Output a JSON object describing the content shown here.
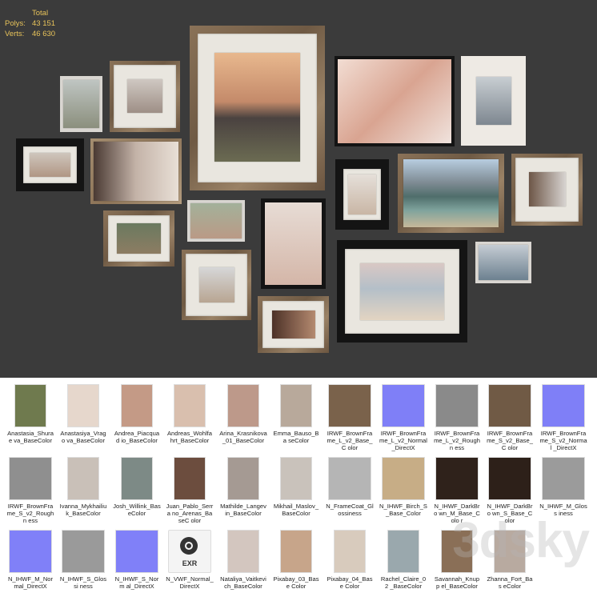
{
  "stats": {
    "total_label": "Total",
    "polys_label": "Polys:",
    "polys_value": "43 151",
    "verts_label": "Verts:",
    "verts_value": "46 630"
  },
  "watermark": "3dsky",
  "exr_label": "EXR",
  "textures": [
    {
      "name": "Anastasia_Shurae va_BaseColor",
      "color": "#6f7a4e"
    },
    {
      "name": "Anastasiya_Vrago va_BaseColor",
      "color": "#e6d7cc"
    },
    {
      "name": "Andrea_Piacquad io_BaseColor",
      "color": "#c49a86"
    },
    {
      "name": "Andreas_Wohlfa hrt_BaseColor",
      "color": "#d9bfae"
    },
    {
      "name": "Arina_Krasnikova _01_BaseColor",
      "color": "#bd998a"
    },
    {
      "name": "Emma_Bauso_Ba seColor",
      "color": "#b8a99b"
    },
    {
      "name": "IRWF_BrownFra me_L_v2_Base_C olor",
      "color": "#7a624b"
    },
    {
      "name": "IRWF_BrownFra me_L_v2_Normal _DirectX",
      "color": "#7f7ff7"
    },
    {
      "name": "IRWF_BrownFra me_L_v2_Roughn ess",
      "color": "#8a8a8a"
    },
    {
      "name": "IRWF_BrownFra me_S_v2_Base_C olor",
      "color": "#705a45"
    },
    {
      "name": "IRWF_BrownFra me_S_v2_Normal _DirectX",
      "color": "#7f7ff7"
    },
    {
      "name": "IRWF_BrownFra me_S_v2_Roughn ess",
      "color": "#8f8f8f"
    },
    {
      "name": "Ivanna_Mykhailiu k_BaseColor",
      "color": "#c9c0b8"
    },
    {
      "name": "Josh_Willink_Bas eColor",
      "color": "#7d8a86"
    },
    {
      "name": "Juan_Pablo_Serra no_Arenas_BaseC olor",
      "color": "#6c4d3e"
    },
    {
      "name": "Mathilde_Langev in_BaseColor",
      "color": "#a59a93"
    },
    {
      "name": "Mikhail_Maslov_ BaseColor",
      "color": "#c9c2bb"
    },
    {
      "name": "N_FrameCoat_Gl ossiness",
      "color": "#b5b5b5"
    },
    {
      "name": "N_IHWF_Birch_S _Base_Color",
      "color": "#c7ad86"
    },
    {
      "name": "N_IHWF_DarkBro wn_M_Base_Colo r",
      "color": "#2f221b"
    },
    {
      "name": "N_IHWF_DarkBro wn_S_Base_Color",
      "color": "#2d2019"
    },
    {
      "name": "N_IHWF_M_Gloss iness",
      "color": "#9b9b9b"
    },
    {
      "name": "N_IHWF_M_Nor mal_DirectX",
      "color": "#8080f8"
    },
    {
      "name": "N_IHWF_S_Glossi ness",
      "color": "#9a9a9a"
    },
    {
      "name": "N_IHWF_S_Norm al_DirectX",
      "color": "#8080f8"
    },
    {
      "name": "N_VWF_Normal_ DirectX",
      "color": "exr"
    },
    {
      "name": "Nataliya_Vaitkevi ch_BaseColor",
      "color": "#d3c6bf"
    },
    {
      "name": "Pixabay_03_Base Color",
      "color": "#c7a58a"
    },
    {
      "name": "Pixabay_04_Base Color",
      "color": "#d8cbbd"
    },
    {
      "name": "Rachel_Claire_02 _BaseColor",
      "color": "#9aa8ad"
    },
    {
      "name": "Savannah_Knupp el_BaseColor",
      "color": "#8a6f57"
    },
    {
      "name": "Zhanna_Fort_Bas eColor",
      "color": "#b8aaa0"
    }
  ]
}
